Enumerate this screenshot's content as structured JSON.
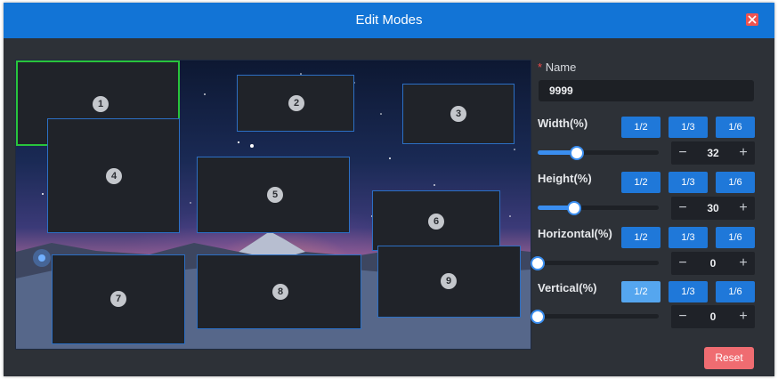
{
  "dialog": {
    "title": "Edit Modes"
  },
  "windows": [
    "1",
    "2",
    "3",
    "4",
    "5",
    "6",
    "7",
    "8",
    "9"
  ],
  "form": {
    "name_label": "Name",
    "name_required_mark": "*",
    "name_value": "9999",
    "width": {
      "label": "Width(%)",
      "value": "32",
      "options": [
        "1/2",
        "1/3",
        "1/6"
      ],
      "level": 32
    },
    "height": {
      "label": "Height(%)",
      "value": "30",
      "options": [
        "1/2",
        "1/3",
        "1/6"
      ],
      "level": 30
    },
    "horizontal": {
      "label": "Horizontal(%)",
      "value": "0",
      "options": [
        "1/2",
        "1/3",
        "1/6"
      ],
      "level": 0
    },
    "vertical": {
      "label": "Vertical(%)",
      "value": "0",
      "options": [
        "1/2",
        "1/3",
        "1/6"
      ],
      "level": 0
    }
  },
  "stepper": {
    "minus": "−",
    "plus": "+"
  },
  "reset_label": "Reset",
  "colors": {
    "header": "#1274d6",
    "accent": "#1f78d9",
    "selected": "#28c43c",
    "reset": "#ef6c71",
    "close": "#f0534f"
  },
  "icons": {
    "close": "close-icon"
  }
}
